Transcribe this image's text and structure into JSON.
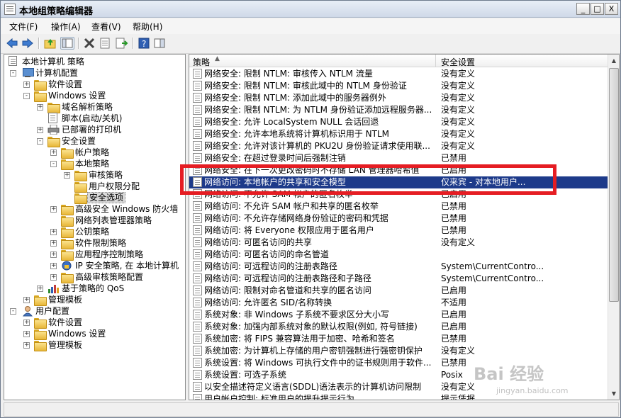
{
  "window": {
    "title": "本地组策略编辑器",
    "minimize": "_",
    "maximize": "□",
    "close": "X"
  },
  "menu": [
    "文件(F)",
    "操作(A)",
    "查看(V)",
    "帮助(H)"
  ],
  "tree": [
    {
      "label": "本地计算机 策略",
      "icon": "policy-icon",
      "level": 0,
      "expander": ""
    },
    {
      "label": "计算机配置",
      "icon": "computer-icon",
      "level": 1,
      "expander": "-"
    },
    {
      "label": "软件设置",
      "icon": "folder-icon",
      "level": 2,
      "expander": "+"
    },
    {
      "label": "Windows 设置",
      "icon": "folder-icon",
      "level": 2,
      "expander": "-"
    },
    {
      "label": "域名解析策略",
      "icon": "folder-icon",
      "level": 3,
      "expander": "+"
    },
    {
      "label": "脚本(启动/关机)",
      "icon": "script-icon",
      "level": 3,
      "expander": ""
    },
    {
      "label": "已部署的打印机",
      "icon": "printer-icon",
      "level": 3,
      "expander": "+"
    },
    {
      "label": "安全设置",
      "icon": "security-icon",
      "level": 3,
      "expander": "-"
    },
    {
      "label": "帐户策略",
      "icon": "folder-icon",
      "level": 4,
      "expander": "+"
    },
    {
      "label": "本地策略",
      "icon": "folder-icon",
      "level": 4,
      "expander": "-"
    },
    {
      "label": "审核策略",
      "icon": "folder-icon",
      "level": 5,
      "expander": "+"
    },
    {
      "label": "用户权限分配",
      "icon": "folder-icon",
      "level": 5,
      "expander": ""
    },
    {
      "label": "安全选项",
      "icon": "folder-icon",
      "level": 5,
      "expander": "",
      "selected": true
    },
    {
      "label": "高级安全 Windows 防火墙",
      "icon": "firewall-icon",
      "level": 4,
      "expander": "+"
    },
    {
      "label": "网络列表管理器策略",
      "icon": "folder-icon",
      "level": 4,
      "expander": ""
    },
    {
      "label": "公钥策略",
      "icon": "folder-icon",
      "level": 4,
      "expander": "+"
    },
    {
      "label": "软件限制策略",
      "icon": "folder-icon",
      "level": 4,
      "expander": "+"
    },
    {
      "label": "应用程序控制策略",
      "icon": "folder-icon",
      "level": 4,
      "expander": "+"
    },
    {
      "label": "IP 安全策略, 在 本地计算机",
      "icon": "ipsec-icon",
      "level": 4,
      "expander": "+"
    },
    {
      "label": "高级审核策略配置",
      "icon": "folder-icon",
      "level": 4,
      "expander": "+"
    },
    {
      "label": "基于策略的 QoS",
      "icon": "qos-chart-icon",
      "level": 3,
      "expander": "+"
    },
    {
      "label": "管理模板",
      "icon": "folder-icon",
      "level": 2,
      "expander": "+"
    },
    {
      "label": "用户配置",
      "icon": "user-icon",
      "level": 1,
      "expander": "-"
    },
    {
      "label": "软件设置",
      "icon": "folder-icon",
      "level": 2,
      "expander": "+"
    },
    {
      "label": "Windows 设置",
      "icon": "folder-icon",
      "level": 2,
      "expander": "+"
    },
    {
      "label": "管理模板",
      "icon": "folder-icon",
      "level": 2,
      "expander": "+"
    }
  ],
  "list": {
    "columns": [
      "策略",
      "安全设置"
    ],
    "rows": [
      {
        "policy": "网络安全: 限制 NTLM: 审核传入 NTLM 流量",
        "setting": "没有定义"
      },
      {
        "policy": "网络安全: 限制 NTLM: 审核此域中的 NTLM 身份验证",
        "setting": "没有定义"
      },
      {
        "policy": "网络安全: 限制 NTLM: 添加此域中的服务器例外",
        "setting": "没有定义"
      },
      {
        "policy": "网络安全: 限制 NTLM: 为 NTLM 身份验证添加远程服务器...",
        "setting": "没有定义"
      },
      {
        "policy": "网络安全: 允许 LocalSystem NULL 会话回退",
        "setting": "没有定义"
      },
      {
        "policy": "网络安全: 允许本地系统将计算机标识用于 NTLM",
        "setting": "没有定义"
      },
      {
        "policy": "网络安全: 允许对该计算机的 PKU2U 身份验证请求使用联...",
        "setting": "没有定义"
      },
      {
        "policy": "网络安全: 在超过登录时间后强制注销",
        "setting": "已禁用"
      },
      {
        "policy": "网络安全: 在下一次更改密码时不存储 LAN 管理器哈希值",
        "setting": "已启用"
      },
      {
        "policy": "网络访问: 本地帐户的共享和安全模型",
        "setting": "仅来宾 - 对本地用户...",
        "selected": true
      },
      {
        "policy": "网络访问: 不允许 SAM 帐户的匿名枚举",
        "setting": "已启用"
      },
      {
        "policy": "网络访问: 不允许 SAM 帐户和共享的匿名枚举",
        "setting": "已禁用"
      },
      {
        "policy": "网络访问: 不允许存储网络身份验证的密码和凭据",
        "setting": "已禁用"
      },
      {
        "policy": "网络访问: 将 Everyone 权限应用于匿名用户",
        "setting": "已禁用"
      },
      {
        "policy": "网络访问: 可匿名访问的共享",
        "setting": "没有定义"
      },
      {
        "policy": "网络访问: 可匿名访问的命名管道",
        "setting": ""
      },
      {
        "policy": "网络访问: 可远程访问的注册表路径",
        "setting": "System\\CurrentContro..."
      },
      {
        "policy": "网络访问: 可远程访问的注册表路径和子路径",
        "setting": "System\\CurrentContro..."
      },
      {
        "policy": "网络访问: 限制对命名管道和共享的匿名访问",
        "setting": "已启用"
      },
      {
        "policy": "网络访问: 允许匿名 SID/名称转换",
        "setting": "不适用"
      },
      {
        "policy": "系统对象: 非 Windows 子系统不要求区分大小写",
        "setting": "已启用"
      },
      {
        "policy": "系统对象: 加强内部系统对象的默认权限(例如, 符号链接)",
        "setting": "已启用"
      },
      {
        "policy": "系统加密: 将 FIPS 兼容算法用于加密、哈希和签名",
        "setting": "已禁用"
      },
      {
        "policy": "系统加密: 为计算机上存储的用户密钥强制进行强密钥保护",
        "setting": "没有定义"
      },
      {
        "policy": "系统设置: 将 Windows 可执行文件中的证书规则用于软件...",
        "setting": "已禁用"
      },
      {
        "policy": "系统设置: 可选子系统",
        "setting": "Posix"
      },
      {
        "policy": "以安全描述符定义语言(SDDL)语法表示的计算机访问限制",
        "setting": "没有定义"
      },
      {
        "policy": "用户帐户控制: 标准用户的提升提示行为",
        "setting": "提示凭据"
      }
    ]
  },
  "watermark": {
    "brand": "Bai 经验",
    "url": "jingyan.baidu.com"
  },
  "colors": {
    "selection": "#1d3a8a",
    "highlight_box": "#e51d23"
  }
}
